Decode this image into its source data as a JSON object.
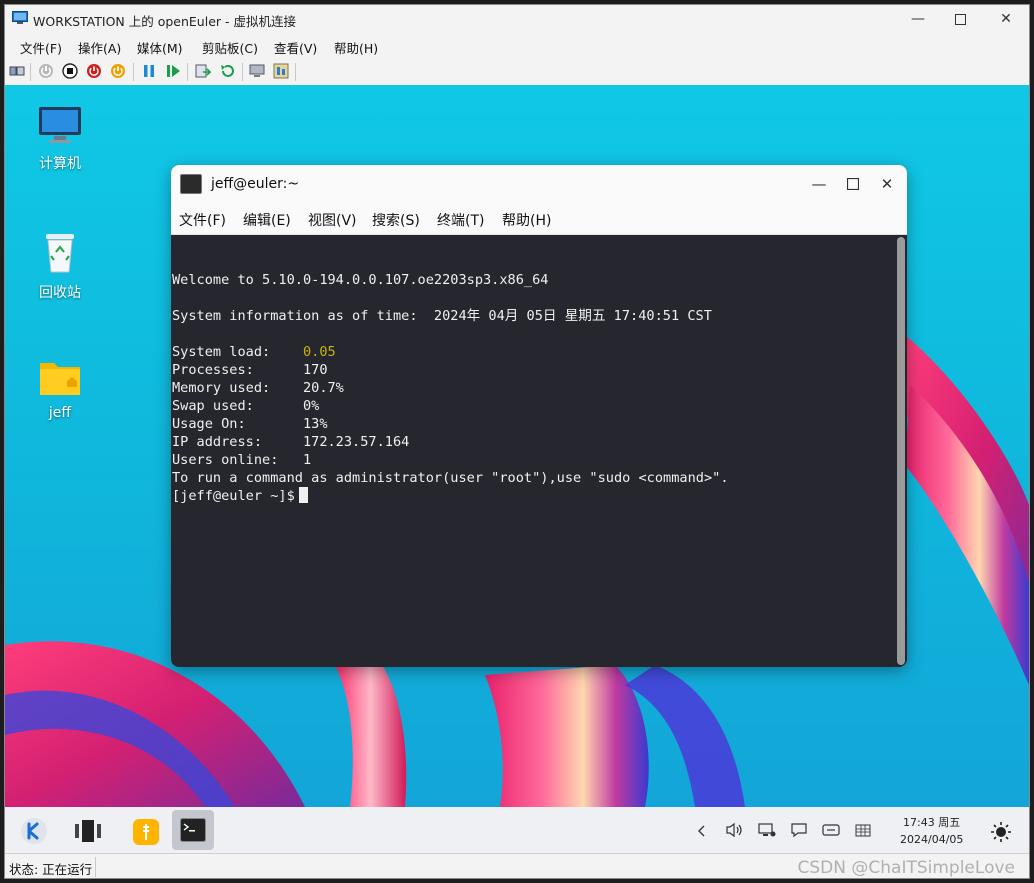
{
  "window": {
    "title": "WORKSTATION 上的 openEuler - 虚拟机连接",
    "minimize_icon": "minimize-icon",
    "maximize_icon": "maximize-icon",
    "close_icon": "close-icon"
  },
  "menu": [
    "文件(F)",
    "操作(A)",
    "媒体(M)",
    "剪贴板(C)",
    "查看(V)",
    "帮助(H)"
  ],
  "toolbar_icons": [
    "ctrl-alt-del-icon",
    "start-icon",
    "turn-off-icon",
    "shutdown-icon",
    "save-icon",
    "pause-icon",
    "resume-icon",
    "checkpoint-icon",
    "revert-icon",
    "enhanced-session-icon",
    "zoom-icon"
  ],
  "desktop": {
    "icons": [
      {
        "label": "计算机",
        "icon": "computer-icon"
      },
      {
        "label": "回收站",
        "icon": "recycle-bin-icon"
      },
      {
        "label": "jeff",
        "icon": "home-folder-icon"
      }
    ]
  },
  "terminal": {
    "title": "jeff@euler:~",
    "menu": [
      "文件(F)",
      "编辑(E)",
      "视图(V)",
      "搜索(S)",
      "终端(T)",
      "帮助(H)"
    ],
    "lines": {
      "welcome": "Welcome to 5.10.0-194.0.0.107.oe2203sp3.x86_64",
      "sysinfo": "System information as of time:  2024年 04月 05日 星期五 17:40:51 CST",
      "load_label": "System load:    ",
      "load_value": "0.05",
      "processes": "Processes:      170",
      "memory": "Memory used:    20.7%",
      "swap": "Swap used:      0%",
      "usage": "Usage On:       13%",
      "ip": "IP address:     172.23.57.164",
      "users": "Users online:   1",
      "sudo_hint": "To run a command as administrator(user \"root\"),use \"sudo <command>\".",
      "prompt": "[jeff@euler ~]$"
    },
    "highlight_color": "#c8b400"
  },
  "taskbar": {
    "clock_time": "17:43 周五",
    "clock_date": "2024/04/05"
  },
  "status": {
    "text": "状态: 正在运行",
    "watermark": "CSDN @ChaITSimpleLove"
  }
}
